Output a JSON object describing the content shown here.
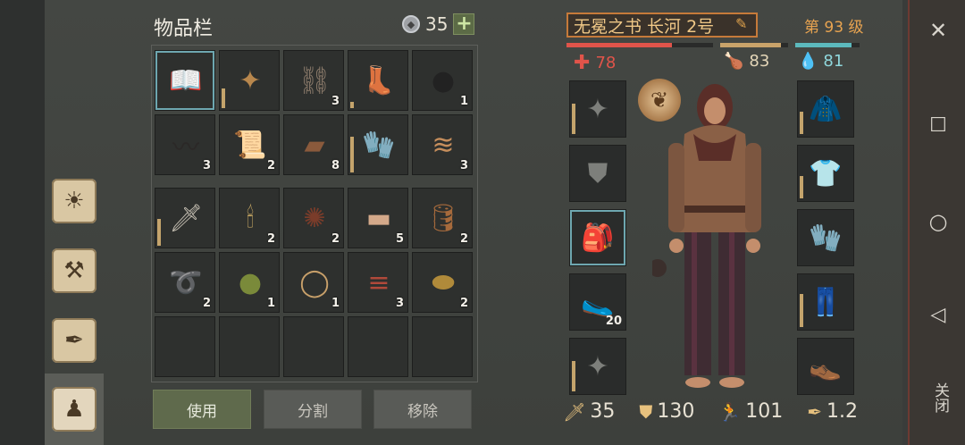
{
  "inventory": {
    "title": "物品栏",
    "coins": "35",
    "add_label": "+",
    "slots": [
      {
        "icon": "📖",
        "qty": "",
        "color": "#6d4fa0",
        "selected": true
      },
      {
        "icon": "✦",
        "qty": "",
        "color": "#b8874d",
        "dur": 34
      },
      {
        "icon": "⛓",
        "qty": "3",
        "color": "#8a7a6a"
      },
      {
        "icon": "👢",
        "qty": "",
        "color": "#4c4844",
        "dur": 10
      },
      {
        "icon": "●",
        "qty": "1",
        "color": "#222"
      },
      {
        "icon": "〰",
        "qty": "3",
        "color": "#2b2827"
      },
      {
        "icon": "📜",
        "qty": "2",
        "color": "#d9c9a8"
      },
      {
        "icon": "▰",
        "qty": "8",
        "color": "#8a5a3c"
      },
      {
        "icon": "🧤",
        "qty": "",
        "color": "#9a6a3e",
        "dur": 60
      },
      {
        "icon": "≋",
        "qty": "3",
        "color": "#c68e5c"
      },
      {
        "icon": "🗡",
        "qty": "",
        "color": "#bfb9ad",
        "dur": 45
      },
      {
        "icon": "🕯",
        "qty": "2",
        "color": "#d9b66a"
      },
      {
        "icon": "✺",
        "qty": "2",
        "color": "#7a3c2a"
      },
      {
        "icon": "▬",
        "qty": "5",
        "color": "#d4a98a"
      },
      {
        "icon": "🛢",
        "qty": "2",
        "color": "#a66a3c"
      },
      {
        "icon": "➰",
        "qty": "2",
        "color": "#7a4a34"
      },
      {
        "icon": "●",
        "qty": "1",
        "color": "#7a8a3a"
      },
      {
        "icon": "◯",
        "qty": "1",
        "color": "#c8a06a"
      },
      {
        "icon": "≡",
        "qty": "3",
        "color": "#b0493a"
      },
      {
        "icon": "⬬",
        "qty": "2",
        "color": "#b08a3a"
      },
      {
        "icon": "",
        "qty": ""
      },
      {
        "icon": "",
        "qty": ""
      },
      {
        "icon": "",
        "qty": ""
      },
      {
        "icon": "",
        "qty": ""
      },
      {
        "icon": "",
        "qty": ""
      }
    ],
    "buttons": {
      "use": "使用",
      "split": "分割",
      "remove": "移除"
    }
  },
  "character": {
    "name": "无冕之书 长河 2号",
    "level": "第 93 级",
    "health": "78",
    "food": "83",
    "water": "81",
    "health_bar": 0.72,
    "food_bar": 0.9,
    "water_bar": 0.88,
    "left_equip": [
      {
        "icon": "✦",
        "qty": "",
        "dur": 55
      },
      {
        "icon": "⛊",
        "qty": ""
      },
      {
        "icon": "🎒",
        "qty": "",
        "selected": true
      },
      {
        "icon": "🥿",
        "qty": "20"
      },
      {
        "icon": "✦",
        "qty": "",
        "dur": 55
      }
    ],
    "right_equip": [
      {
        "icon": "🧥",
        "qty": "",
        "dur": 40
      },
      {
        "icon": "👕",
        "qty": "",
        "dur": 40
      },
      {
        "icon": "🧤",
        "qty": ""
      },
      {
        "icon": "👖",
        "qty": "",
        "dur": 60
      },
      {
        "icon": "👞",
        "qty": ""
      }
    ],
    "stats": {
      "attack": "35",
      "armor": "130",
      "speed": "101",
      "weight": "1.2"
    }
  },
  "system": {
    "close_label": "关闭"
  },
  "colors": {
    "health": "#e0544a",
    "food": "#c9a36a",
    "water": "#5cb9bd"
  }
}
